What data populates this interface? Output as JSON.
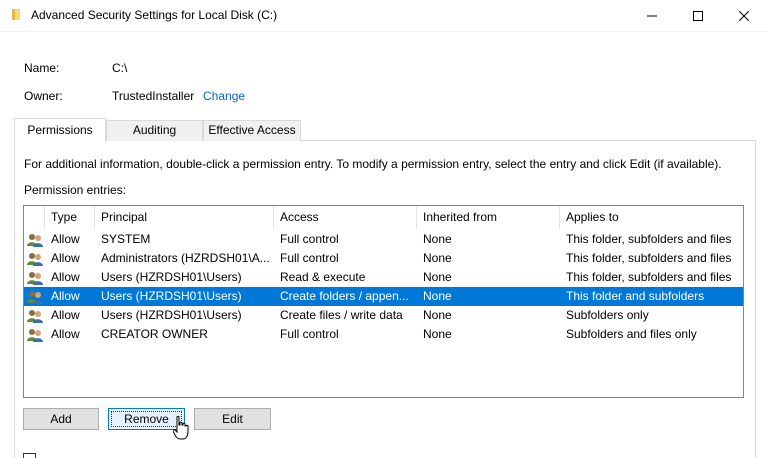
{
  "window": {
    "title": "Advanced Security Settings for Local Disk (C:)"
  },
  "fields": {
    "name_label": "Name:",
    "name_value": "C:\\",
    "owner_label": "Owner:",
    "owner_value": "TrustedInstaller",
    "change_link": "Change"
  },
  "tabs": [
    {
      "label": "Permissions",
      "active": true
    },
    {
      "label": "Auditing",
      "active": false
    },
    {
      "label": "Effective Access",
      "active": false
    }
  ],
  "permissions": {
    "info_text": "For additional information, double-click a permission entry. To modify a permission entry, select the entry and click Edit (if available).",
    "entries_label": "Permission entries:",
    "columns": [
      "Type",
      "Principal",
      "Access",
      "Inherited from",
      "Applies to"
    ],
    "rows": [
      {
        "type": "Allow",
        "principal": "SYSTEM",
        "access": "Full control",
        "inherited": "None",
        "applies": "This folder, subfolders and files",
        "selected": false
      },
      {
        "type": "Allow",
        "principal": "Administrators (HZRDSH01\\A...",
        "access": "Full control",
        "inherited": "None",
        "applies": "This folder, subfolders and files",
        "selected": false
      },
      {
        "type": "Allow",
        "principal": "Users (HZRDSH01\\Users)",
        "access": "Read & execute",
        "inherited": "None",
        "applies": "This folder, subfolders and files",
        "selected": false
      },
      {
        "type": "Allow",
        "principal": "Users (HZRDSH01\\Users)",
        "access": "Create folders / appen...",
        "inherited": "None",
        "applies": "This folder and subfolders",
        "selected": true
      },
      {
        "type": "Allow",
        "principal": "Users (HZRDSH01\\Users)",
        "access": "Create files / write data",
        "inherited": "None",
        "applies": "Subfolders only",
        "selected": false
      },
      {
        "type": "Allow",
        "principal": "CREATOR OWNER",
        "access": "Full control",
        "inherited": "None",
        "applies": "Subfolders and files only",
        "selected": false
      }
    ]
  },
  "buttons": {
    "add": "Add",
    "remove": "Remove",
    "edit": "Edit"
  },
  "icons": {
    "title": "folder-icon",
    "row": "users-icon",
    "cursor": "mouse-cursor-icon"
  },
  "colors": {
    "selection": "#0078d7",
    "link": "#0066cc"
  }
}
